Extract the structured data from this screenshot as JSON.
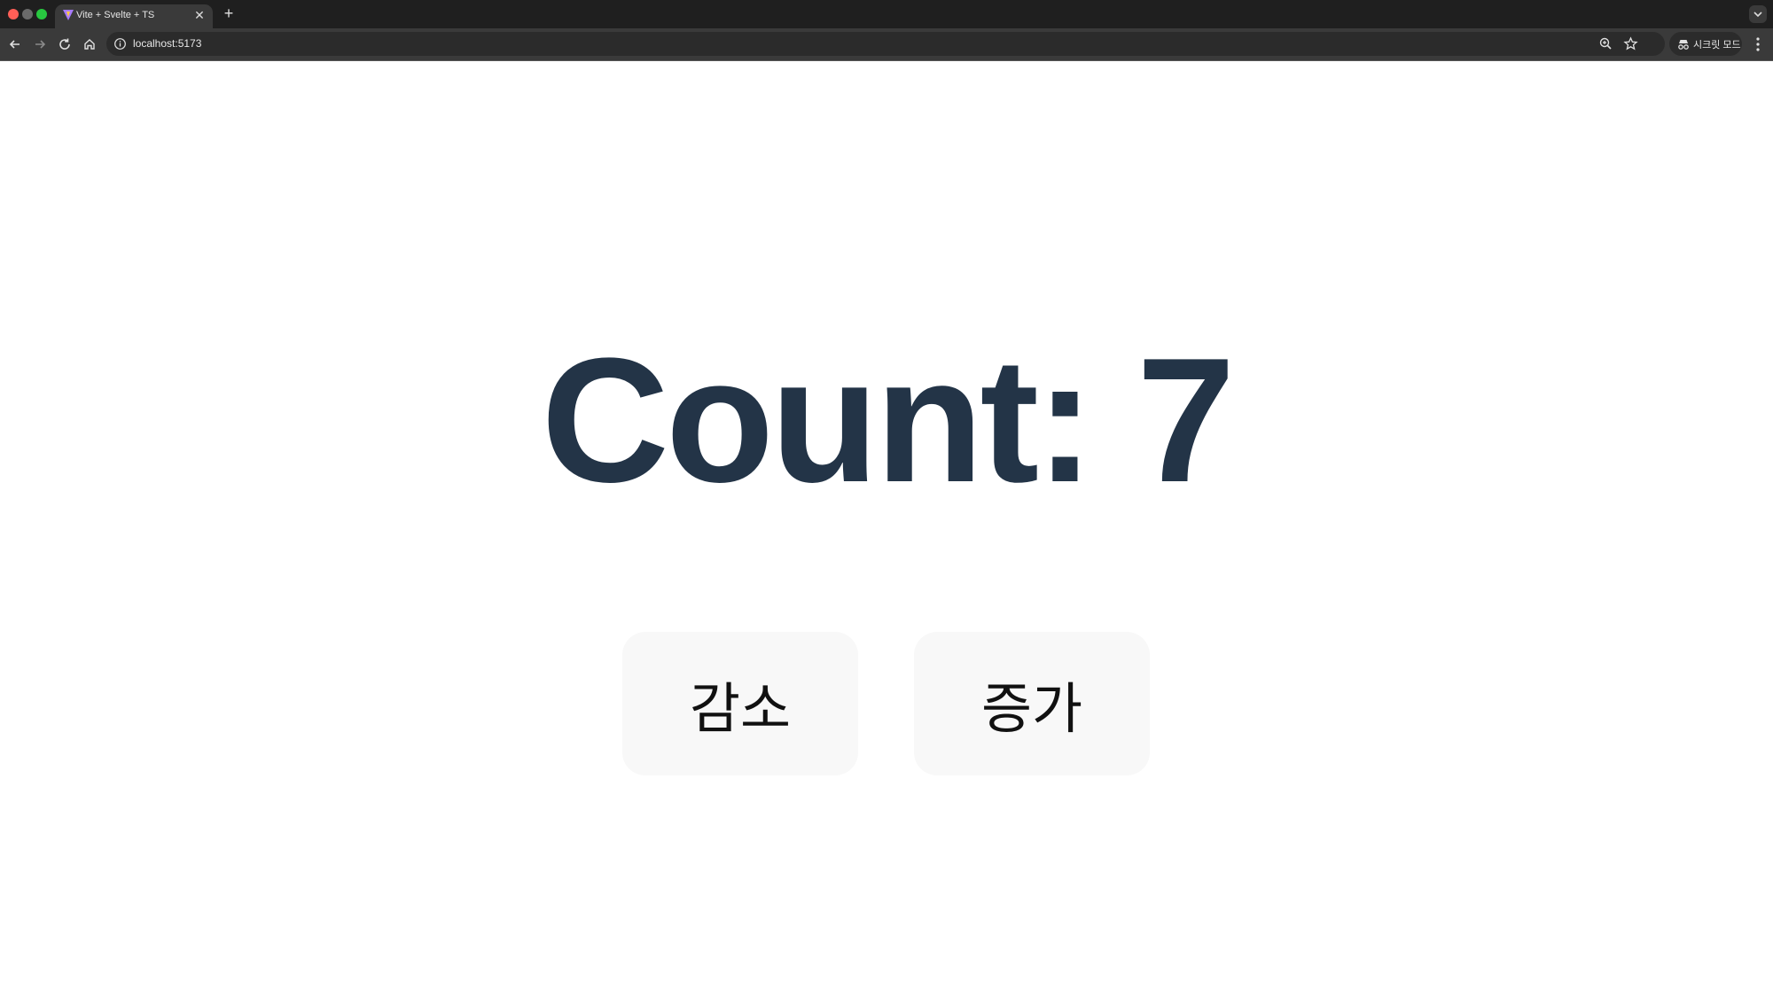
{
  "browser": {
    "tab": {
      "title": "Vite + Svelte + TS"
    },
    "url": "localhost:5173",
    "incognito_label": "시크릿 모드"
  },
  "page": {
    "count_text": "Count: 7",
    "decrement_label": "감소",
    "increment_label": "증가"
  },
  "colors": {
    "count_text": "#233447",
    "button_bg": "#f8f8f8",
    "chrome_dark": "#1f1f1f",
    "toolbar": "#3a3a3a"
  },
  "icons": [
    "close-icon",
    "plus-icon",
    "back-arrow-icon",
    "forward-arrow-icon",
    "reload-icon",
    "home-icon",
    "info-icon",
    "zoom-icon",
    "star-icon",
    "incognito-icon",
    "kebab-menu-icon",
    "chevron-down-icon"
  ]
}
